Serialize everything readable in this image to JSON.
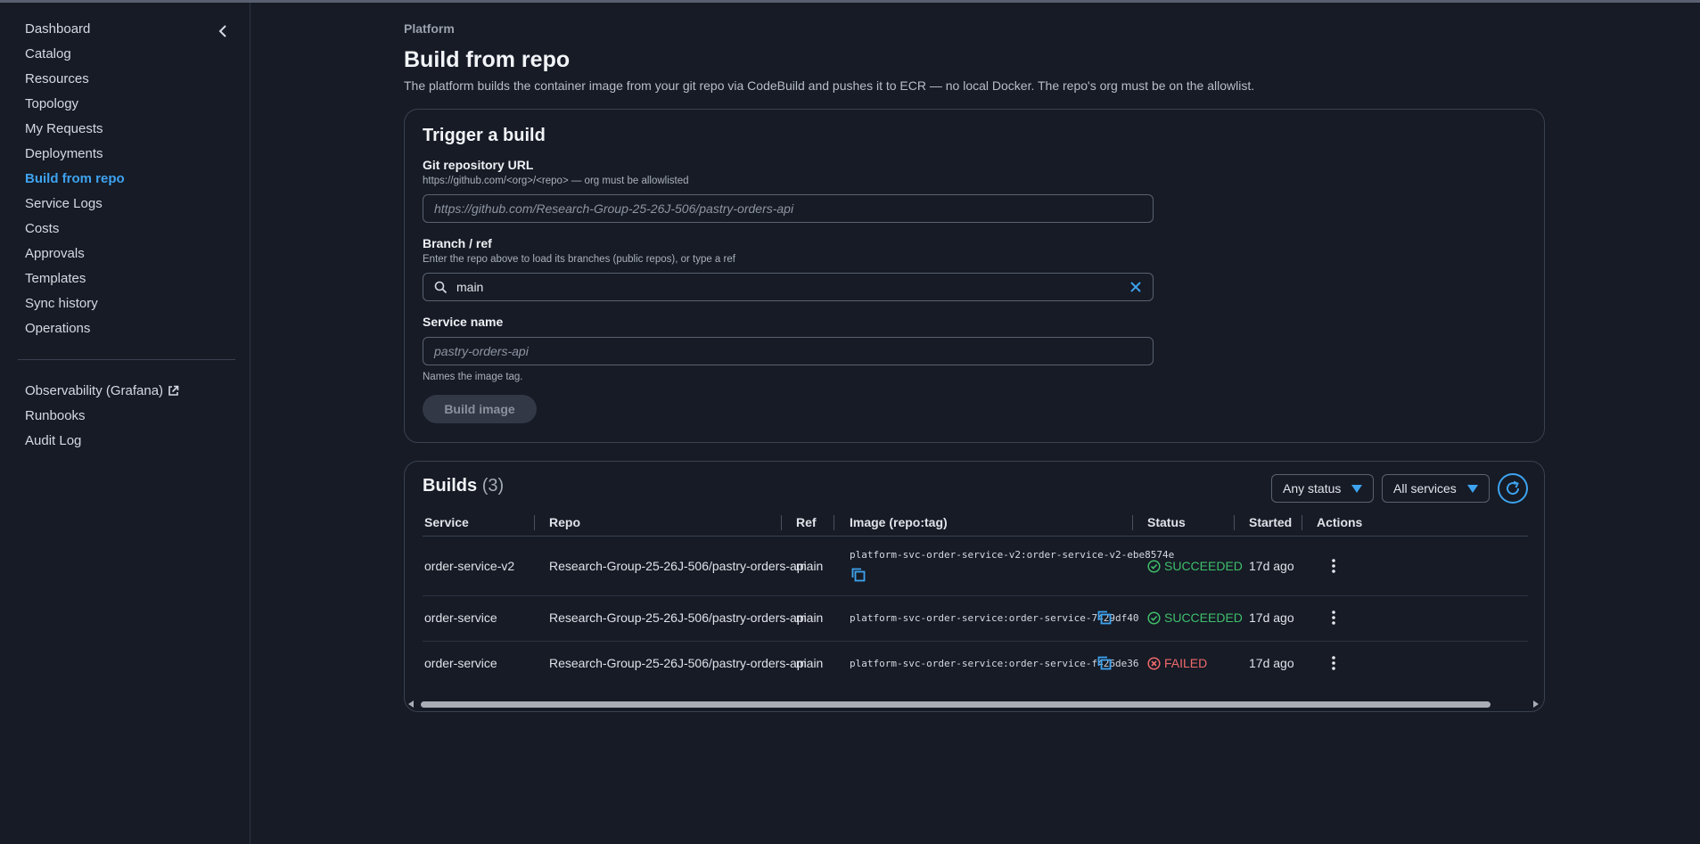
{
  "sidebar": {
    "items": [
      {
        "label": "Dashboard",
        "active": false
      },
      {
        "label": "Catalog",
        "active": false
      },
      {
        "label": "Resources",
        "active": false
      },
      {
        "label": "Topology",
        "active": false
      },
      {
        "label": "My Requests",
        "active": false
      },
      {
        "label": "Deployments",
        "active": false
      },
      {
        "label": "Build from repo",
        "active": true
      },
      {
        "label": "Service Logs",
        "active": false
      },
      {
        "label": "Costs",
        "active": false
      },
      {
        "label": "Approvals",
        "active": false
      },
      {
        "label": "Templates",
        "active": false
      },
      {
        "label": "Sync history",
        "active": false
      },
      {
        "label": "Operations",
        "active": false
      }
    ],
    "secondary": [
      {
        "label": "Observability (Grafana)",
        "icon": "external-link-icon"
      },
      {
        "label": "Runbooks"
      },
      {
        "label": "Audit Log"
      }
    ],
    "collapse_icon": "chevron-left-icon"
  },
  "header": {
    "breadcrumb": "Platform",
    "title": "Build from repo",
    "description": "The platform builds the container image from your git repo via CodeBuild and pushes it to ECR — no local Docker. The repo's org must be on the allowlist."
  },
  "trigger": {
    "title": "Trigger a build",
    "repo_label": "Git repository URL",
    "repo_help": "https://github.com/<org>/<repo> — org must be allowlisted",
    "repo_placeholder": "https://github.com/Research-Group-25-26J-506/pastry-orders-api",
    "repo_value": "",
    "branch_label": "Branch / ref",
    "branch_help": "Enter the repo above to load its branches (public repos), or type a ref",
    "branch_value": "main",
    "service_label": "Service name",
    "service_placeholder": "pastry-orders-api",
    "service_value": "",
    "service_help": "Names the image tag.",
    "build_button": "Build image"
  },
  "builds": {
    "title": "Builds",
    "count": "(3)",
    "status_filter": "Any status",
    "service_filter": "All services",
    "columns": [
      "Service",
      "Repo",
      "Ref",
      "Image (repo:tag)",
      "Status",
      "Started",
      "Actions"
    ],
    "rows": [
      {
        "service": "order-service-v2",
        "repo": "Research-Group-25-26J-506/pastry-orders-api",
        "ref": "main",
        "image": "platform-svc-order-service-v2:order-service-v2-ebe8574e",
        "status": "SUCCEEDED",
        "status_kind": "ok",
        "started": "17d ago"
      },
      {
        "service": "order-service",
        "repo": "Research-Group-25-26J-506/pastry-orders-api",
        "ref": "main",
        "image": "platform-svc-order-service:order-service-7429df40",
        "status": "SUCCEEDED",
        "status_kind": "ok",
        "started": "17d ago"
      },
      {
        "service": "order-service",
        "repo": "Research-Group-25-26J-506/pastry-orders-api",
        "ref": "main",
        "image": "platform-svc-order-service:order-service-f426de36",
        "status": "FAILED",
        "status_kind": "fail",
        "started": "17d ago"
      }
    ]
  },
  "colors": {
    "background": "#161b26",
    "accent": "#3ea3ef",
    "success": "#3fbf6a",
    "failure": "#f06a6a"
  }
}
